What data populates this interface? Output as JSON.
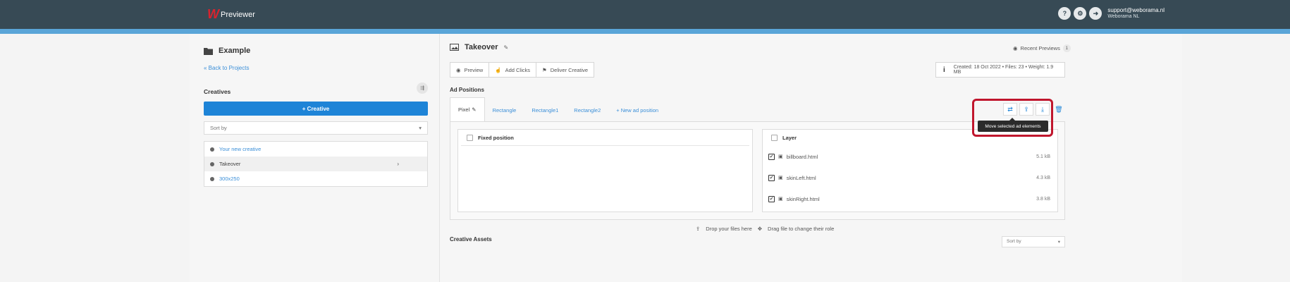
{
  "header": {
    "logo_mark": "W",
    "app_name": "Previewer",
    "help_icon": "?",
    "settings_icon": "⚙",
    "logout_icon": "➜",
    "user_email": "support@weborama.nl",
    "user_org": "Weborama NL"
  },
  "sidebar": {
    "project_title": "Example",
    "back_link": "« Back to Projects",
    "creatives_label": "Creatives",
    "add_creative_label": "+ Creative",
    "sort_placeholder": "Sort by",
    "creatives": [
      {
        "name": "Your new creative"
      },
      {
        "name": "Takeover"
      },
      {
        "name": "300x250"
      }
    ]
  },
  "main": {
    "creative_title": "Takeover",
    "recent_previews_label": "Recent Previews",
    "recent_previews_count": "1",
    "actions": {
      "preview": "Preview",
      "add_clicks": "Add Clicks",
      "deliver": "Deliver Creative"
    },
    "info": "Created: 18 Oct 2022 • Files: 23 • Weight: 1.9 MB",
    "ad_positions_label": "Ad Positions",
    "tabs": [
      {
        "label": "Pixel"
      },
      {
        "label": "Rectangle"
      },
      {
        "label": "Rectangle1"
      },
      {
        "label": "Rectangle2"
      }
    ],
    "new_position_label": "+ New ad position",
    "tooltip": "Move selected ad elements",
    "fixed_position_label": "Fixed position",
    "layer_label": "Layer",
    "layers": [
      {
        "file": "billboard.html",
        "size": "5.1 kB"
      },
      {
        "file": "skinLeft.html",
        "size": "4.3 kB"
      },
      {
        "file": "skinRight.html",
        "size": "3.8 kB"
      }
    ],
    "drop_hint": "Drop your files here",
    "drag_hint": "Drag file to change their role",
    "creative_assets_label": "Creative Assets",
    "assets_sort": "Sort by"
  }
}
